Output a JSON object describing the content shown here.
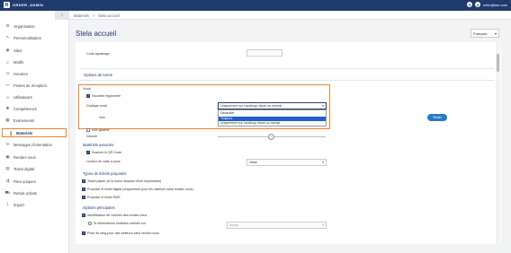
{
  "header": {
    "brand_logo": "R",
    "brand_name": "ORDER_ADMIN",
    "user": "neko@aur.com"
  },
  "sidebar": {
    "collapse_icon": "‹",
    "items": [
      {
        "label": "Organisation"
      },
      {
        "label": "Personnalisation"
      },
      {
        "label": "Sites"
      },
      {
        "label": "Motifs"
      },
      {
        "label": "Horaires"
      },
      {
        "label": "Postes de réception"
      },
      {
        "label": "Utilisateurs"
      },
      {
        "label": "Compétences"
      },
      {
        "label": "Evénements"
      },
      {
        "label": "Materiels"
      },
      {
        "label": "Messages d'orientation"
      },
      {
        "label": "Rendez-vous"
      },
      {
        "label": "Ticket digital"
      },
      {
        "label": "Files uniques"
      },
      {
        "label": "Retrait achats"
      },
      {
        "label": "Import"
      }
    ]
  },
  "breadcrumb": {
    "parent": "Materiels",
    "sep": ">",
    "current": "Stela accueil"
  },
  "page": {
    "title": "Stela accueil",
    "language": "Français"
  },
  "form": {
    "code_appairage_label": "Code appairage",
    "section_options_borne": "Options de borne",
    "vocal_label": "Vocal",
    "nouvelle_ergonomie": "Nouvelle ergonomie",
    "guidage_vocal_label": "Guidage vocal",
    "guidage_vocal_value": "Uniquement sur handicap visuel ou mental",
    "guidage_options": [
      "Désactivé",
      "Toujours",
      "Uniquement sur handicap visuel ou mental"
    ],
    "voix_label": "Voix",
    "tester_button": "Tester",
    "voix_gauche": "Voix gauche",
    "volume_label": "Volume",
    "section_materiels_associes": "Matériels associés",
    "scanner_qr": "Scanner le QR Code",
    "lecteur_carte_label": "Lecteur de carte à puce",
    "lecteur_carte_value": "Vitale",
    "section_types_tickets": "Types de tickets proposés",
    "ticket_papier": "Ticket papier (si la borne dispose d'une imprimante)",
    "ticket_digital": "Proposer le ticket digital (uniquement pour les visiteurs sans rendez-vous)",
    "ticket_sms": "Proposer le ticket SMS",
    "section_options_principales": "Options principales",
    "identification": "Identification de l'arrivée des rendez-vous",
    "si_informations": "Si informations invalides orienter sur",
    "orienter_value": "Aucun",
    "prise_de_rang": "Prise de rang pour des visiteurs sans rendez-vous"
  },
  "colors": {
    "nav_bg": "#1f3b6e",
    "accent": "#e8832a",
    "button": "#2878c8",
    "selected_option": "#1f5fc9"
  },
  "icons": {
    "dropdown": "▾",
    "check": "✓",
    "user": "user-icon",
    "settings": "gear-icon"
  }
}
